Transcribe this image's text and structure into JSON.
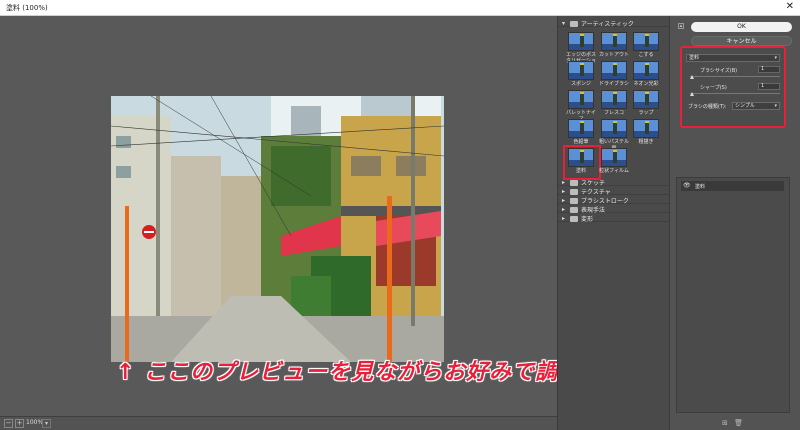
{
  "window": {
    "title": "塗料 (100%)",
    "close_glyph": "✕"
  },
  "preview": {
    "annotation": "↑ ここのプレビューを見ながらお好みで調整",
    "zoom_level": "100%",
    "zoom_out_glyph": "−",
    "zoom_in_glyph": "+",
    "dropdown_glyph": "▾"
  },
  "gallery": {
    "open_folder": "アーティスティック",
    "thumbnails": [
      {
        "label": "エッジのポスタリゼーション"
      },
      {
        "label": "カットアウト"
      },
      {
        "label": "こする"
      },
      {
        "label": "スポンジ"
      },
      {
        "label": "ドライブラシ"
      },
      {
        "label": "ネオン光彩"
      },
      {
        "label": "パレットナイフ"
      },
      {
        "label": "フレスコ"
      },
      {
        "label": "ラップ"
      },
      {
        "label": "色鉛筆"
      },
      {
        "label": "粗いパステル画"
      },
      {
        "label": "粗描き"
      },
      {
        "label": "塗料"
      },
      {
        "label": "粒状フィルム"
      }
    ],
    "selected_thumbnail": "塗料",
    "folders": [
      "スケッチ",
      "テクスチャ",
      "ブラシストローク",
      "表現手法",
      "変形"
    ],
    "open_arrow": "▾",
    "closed_arrow": "▸"
  },
  "panel": {
    "ok_label": "OK",
    "cancel_label": "キャンセル",
    "collapse_glyph": "▴",
    "filter_select": "塗料",
    "brush_size_label": "ブラシサイズ(B)",
    "brush_size_value": "1",
    "brush_size_level": 0.02,
    "sharpness_label": "シャープ(S)",
    "sharpness_value": "1",
    "sharpness_level": 0.025,
    "brush_type_label": "ブラシの種類(T):",
    "brush_type_value": "シンプル",
    "caret_glyph": "▾",
    "layer_name": "塗料",
    "eye_glyph": "👁",
    "new_layer_glyph": "⊞",
    "delete_layer_glyph": "🗑"
  },
  "colors": {
    "highlight": "#e8203a",
    "panel_bg": "#535353"
  }
}
